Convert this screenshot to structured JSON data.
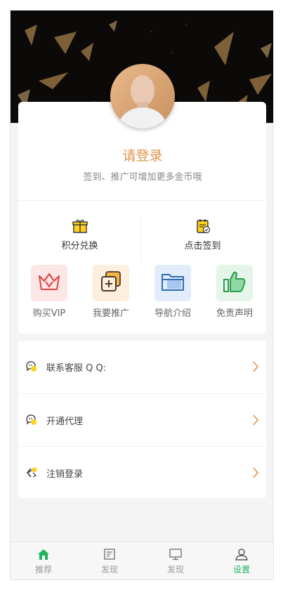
{
  "profile": {
    "title": "请登录",
    "subtitle": "签到、推广可增加更多金币哦"
  },
  "actions": [
    {
      "label": "积分兑换",
      "icon": "gift-icon"
    },
    {
      "label": "点击签到",
      "icon": "checkin-icon"
    }
  ],
  "grid": [
    {
      "label": "购买VIP",
      "icon": "crown-icon",
      "bg": "#fde7e6",
      "color": "#e0413a"
    },
    {
      "label": "我要推广",
      "icon": "promote-icon",
      "bg": "#fdeedd",
      "color": "#4a3a28"
    },
    {
      "label": "导航介绍",
      "icon": "folder-icon",
      "bg": "#e1edfb",
      "color": "#2f6bb5"
    },
    {
      "label": "免责声明",
      "icon": "thumbs-up-icon",
      "bg": "#e6f5ea",
      "color": "#2e9c4d"
    }
  ],
  "list": [
    {
      "label": "联系客服 Q Q:",
      "icon": "chat-bubble-icon"
    },
    {
      "label": "开通代理",
      "icon": "chat-bubble-icon"
    },
    {
      "label": "注销登录",
      "icon": "logout-icon"
    }
  ],
  "tabs": [
    {
      "label": "推荐",
      "icon": "home-icon",
      "active": false
    },
    {
      "label": "发现",
      "icon": "article-icon",
      "active": false
    },
    {
      "label": "发现",
      "icon": "monitor-icon",
      "active": false
    },
    {
      "label": "设置",
      "icon": "user-icon",
      "active": true
    }
  ],
  "colors": {
    "accent": "#e2934a",
    "active_tab": "#22b35e",
    "header_bg": "#0b0a08"
  }
}
